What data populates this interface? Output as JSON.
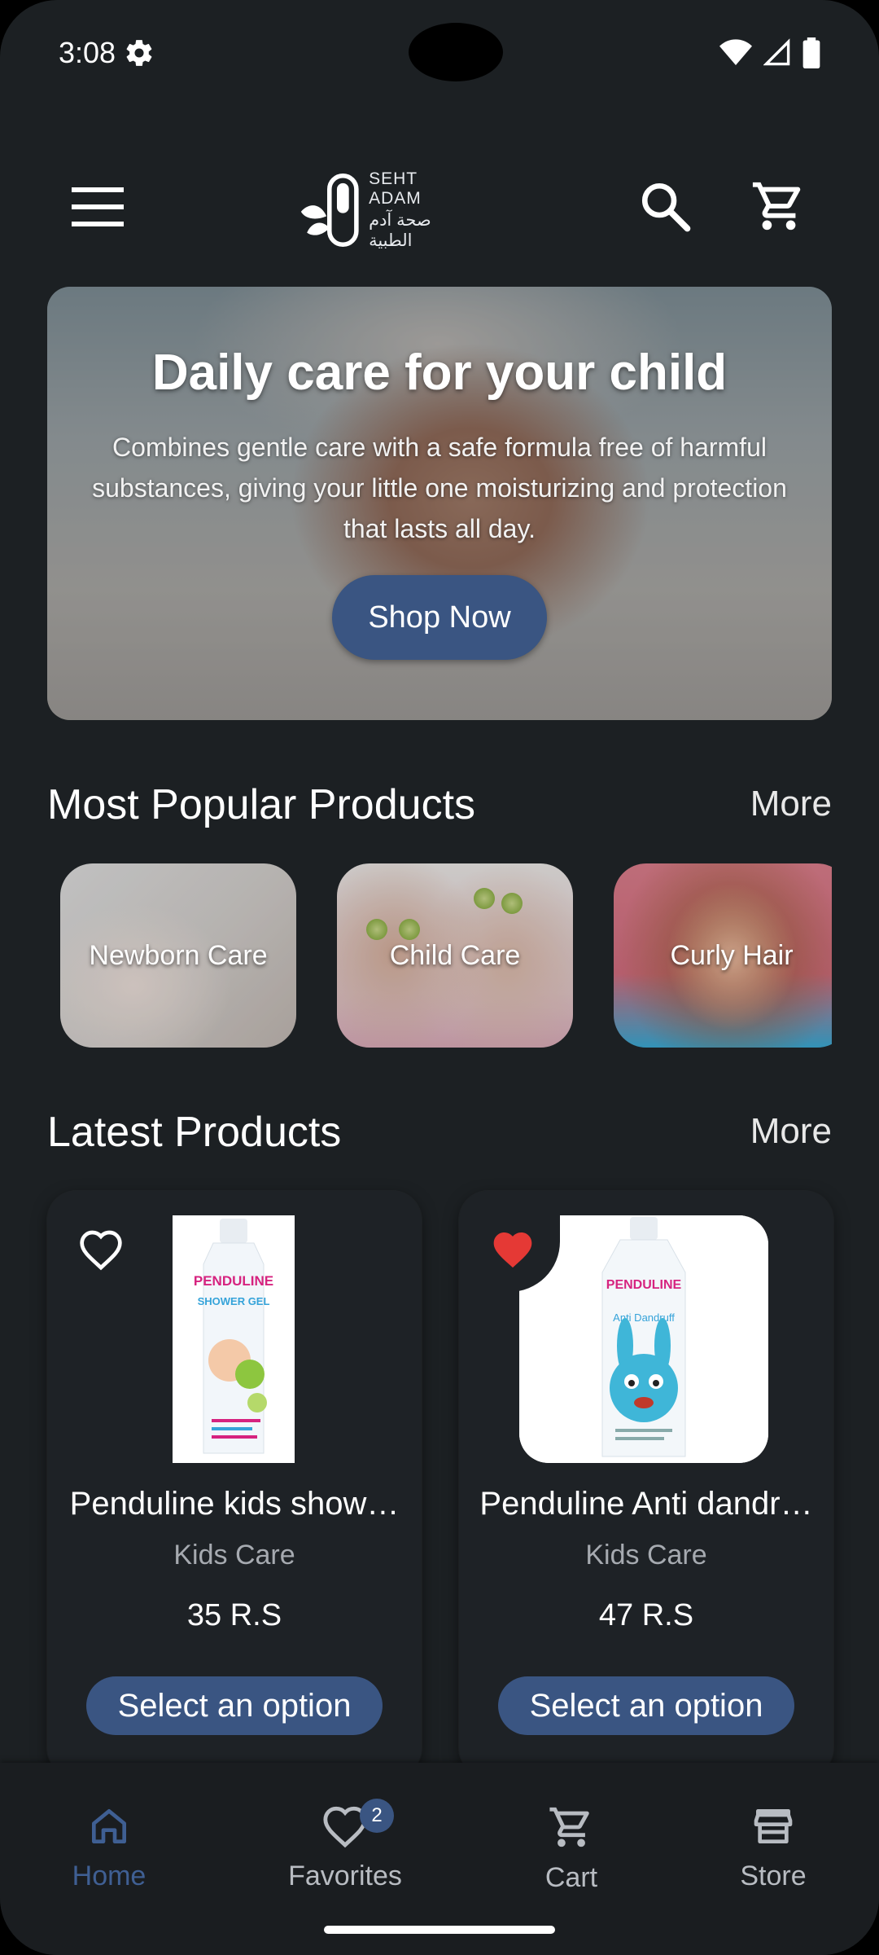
{
  "status_bar": {
    "time": "3:08"
  },
  "header": {
    "logo_en": "SEHT ADAM",
    "logo_ar": "صحة آدم الطبية"
  },
  "hero": {
    "title": "Daily care for your child",
    "subtitle": "Combines gentle care with a safe formula free of harmful substances, giving your little one moisturizing and protection that lasts all day.",
    "button": "Shop Now"
  },
  "popular": {
    "title": "Most Popular Products",
    "more": "More",
    "categories": [
      {
        "label": "Newborn Care"
      },
      {
        "label": "Child Care"
      },
      {
        "label": "Curly Hair"
      }
    ]
  },
  "latest": {
    "title": "Latest Products",
    "more": "More",
    "products": [
      {
        "name": "Penduline kids show…",
        "category": "Kids Care",
        "price": "35 R.S",
        "button": "Select an option",
        "favorite": false,
        "brand": "PENDULINE",
        "label": "SHOWER GEL"
      },
      {
        "name": "Penduline Anti dandr…",
        "category": "Kids Care",
        "price": "47 R.S",
        "button": "Select an option",
        "favorite": true,
        "brand": "PENDULINE",
        "label": "Anti Dandruff"
      }
    ]
  },
  "bottom_nav": {
    "items": [
      {
        "label": "Home",
        "icon": "home-icon",
        "active": true
      },
      {
        "label": "Favorites",
        "icon": "heart-icon",
        "badge": "2"
      },
      {
        "label": "Cart",
        "icon": "cart-icon"
      },
      {
        "label": "Store",
        "icon": "store-icon"
      }
    ]
  },
  "colors": {
    "background": "#1c2023",
    "accent": "#3a5582",
    "favorite_red": "#e53935",
    "nav_active": "#3f5f93"
  }
}
